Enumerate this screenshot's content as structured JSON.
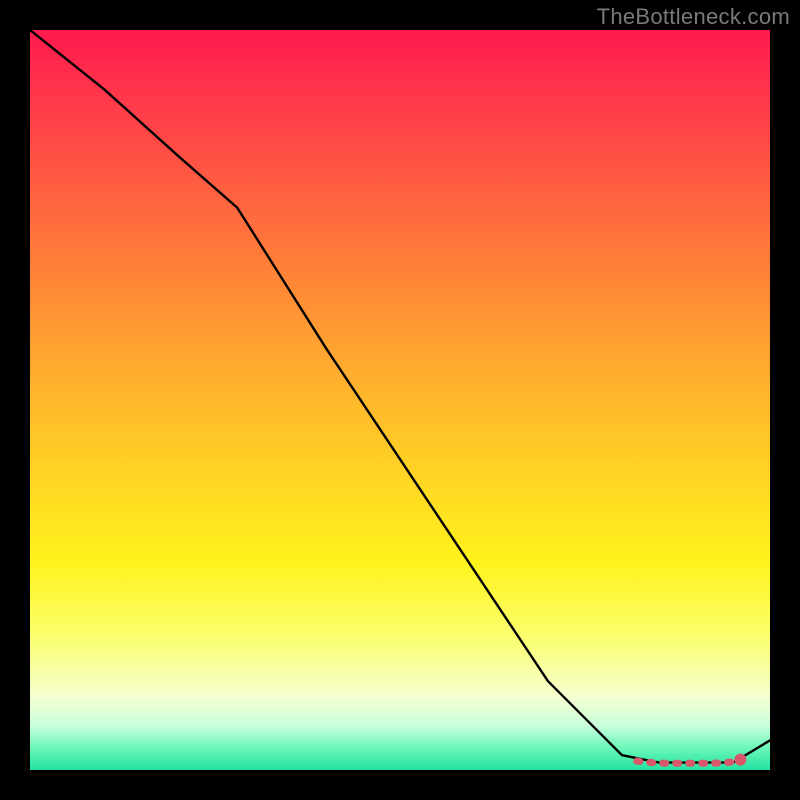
{
  "watermark": "TheBottleneck.com",
  "chart_data": {
    "type": "line",
    "title": "",
    "xlabel": "",
    "ylabel": "",
    "xlim": [
      0,
      100
    ],
    "ylim": [
      0,
      100
    ],
    "series": [
      {
        "name": "bottleneck-curve",
        "x": [
          0,
          10,
          20,
          28,
          40,
          50,
          60,
          70,
          80,
          85,
          90,
          95,
          100
        ],
        "y": [
          100,
          92,
          83,
          76,
          57,
          42,
          27,
          12,
          2,
          1,
          1,
          1,
          4
        ]
      }
    ],
    "highlight": {
      "name": "optimal-range",
      "x": [
        82,
        84,
        86,
        88,
        90,
        92,
        94,
        96
      ],
      "y": [
        1.2,
        1.0,
        0.9,
        0.9,
        0.9,
        0.9,
        1.0,
        1.2
      ]
    },
    "highlight_point": {
      "x": 96,
      "y": 1.4
    }
  },
  "colors": {
    "curve": "#000000",
    "highlight": "#d9576a",
    "highlight_point": "#d9576a"
  }
}
